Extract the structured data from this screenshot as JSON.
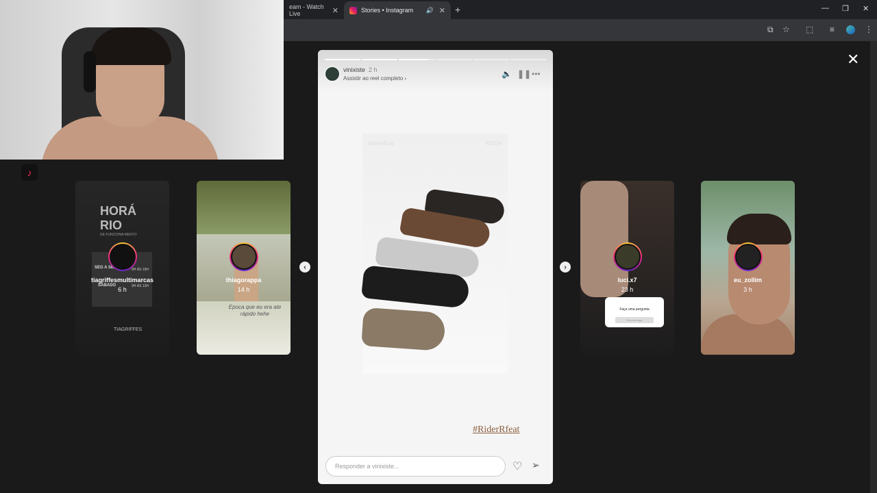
{
  "browser": {
    "tabs": [
      {
        "label": "eam - Watch Live",
        "close": "✕"
      },
      {
        "label": "Stories • Instagram",
        "close": "✕"
      }
    ],
    "new_tab": "+",
    "window_controls": {
      "minimize": "—",
      "restore": "❐",
      "close": "✕"
    }
  },
  "viewer": {
    "close_label": "✕",
    "prev_label": "‹",
    "next_label": "›"
  },
  "stories": [
    {
      "username": "tiagriffesmultimarcas",
      "time": "6 h",
      "heading": "HORÁ\nRIO",
      "subheading": "DE FUNCIONA MENTO",
      "line1": "SEG A SEX",
      "hours1": "9H ÀS 19H",
      "line2": "SÁBADO",
      "hours2": "9H ÀS 13H",
      "logo": "TIAGRIFFES"
    },
    {
      "username": "thiagorappa",
      "time": "14 h",
      "caption": "Epoca que eu era ate rápido hehe"
    },
    {
      "username": "luci.x7",
      "time": "23 h",
      "question": "Faça uma pergunta",
      "question_input": "Escreva algo"
    },
    {
      "username": "eu_zollim",
      "time": "3 h"
    }
  ],
  "main_story": {
    "username": "vinixiste",
    "time": "2 h",
    "reel_link": "Assistir ao reel completo ›",
    "hashtag": "#RiderRfeat",
    "watermark_left": "#identificar",
    "watermark_right": "RIDER",
    "reply_placeholder": "Responder a vinixiste...",
    "progress": {
      "segments": 6,
      "completed": 2,
      "current_fraction": 0.8
    }
  }
}
